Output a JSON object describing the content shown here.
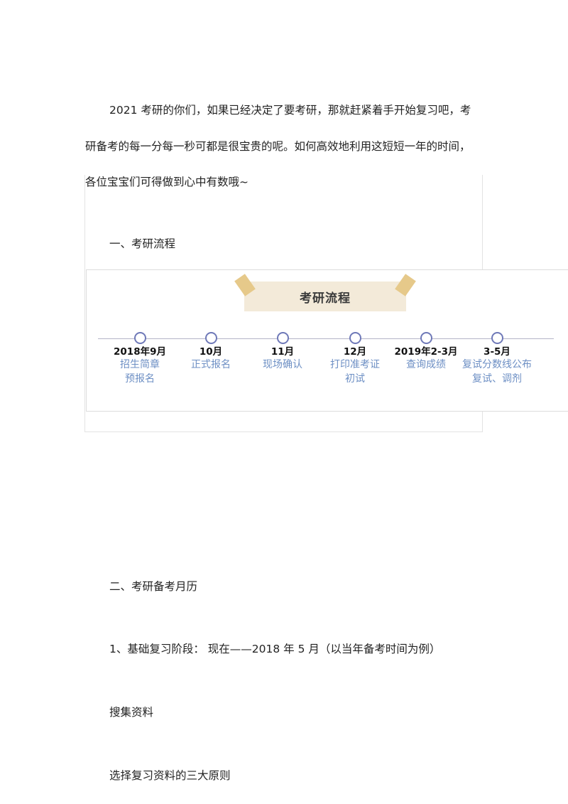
{
  "intro": {
    "line1": "2021 考研的你们，如果已经决定了要考研，那就赶紧着手开始复习吧，考",
    "line2": "研备考的每一分每一秒可都是很宝贵的呢。如何高效地利用这短短一年的时间，",
    "line3": "各位宝宝们可得做到心中有数哦~"
  },
  "section1": {
    "heading": "一、考研流程",
    "figure_title": "考研流程",
    "timeline": [
      {
        "date": "2018年9月",
        "desc": [
          "招生简章",
          "预报名"
        ]
      },
      {
        "date": "10月",
        "desc": [
          "正式报名"
        ]
      },
      {
        "date": "11月",
        "desc": [
          "现场确认"
        ]
      },
      {
        "date": "12月",
        "desc": [
          "打印准考证",
          "初试"
        ]
      },
      {
        "date": "2019年2-3月",
        "desc": [
          "查询成绩"
        ]
      },
      {
        "date": "3-5月",
        "desc": [
          "复试分数线公布",
          "复试、调剂"
        ]
      }
    ]
  },
  "section2": {
    "heading": "二、考研备考月历",
    "stage1": "1、基础复习阶段：  现在——2018 年 5 月（以当年备考时间为例）",
    "item1": "搜集资料",
    "item2": "选择复习资料的三大原则"
  },
  "colors": {
    "text": "#222222",
    "timeline_desc": "#6d8fc4",
    "node_ring": "#6f79b8",
    "banner": "#f3ead9",
    "tape": "#e6c98a"
  }
}
